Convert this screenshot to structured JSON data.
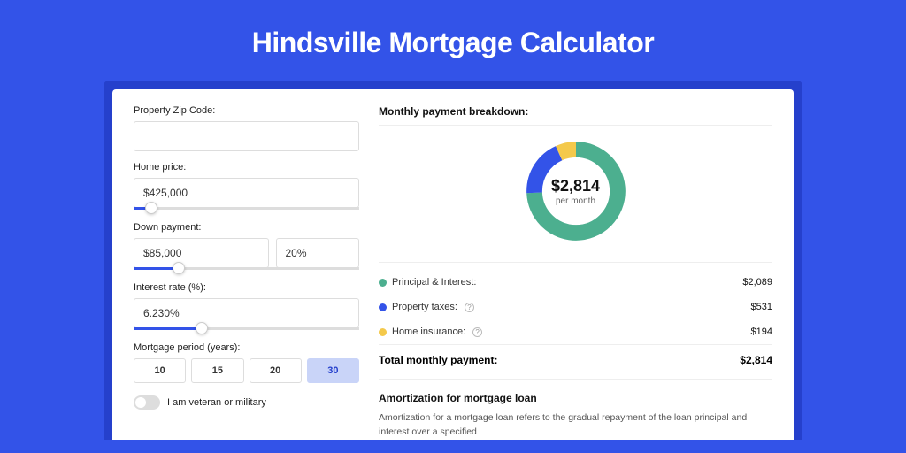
{
  "hero": {
    "title": "Hindsville Mortgage Calculator"
  },
  "form": {
    "zip_label": "Property Zip Code:",
    "zip_value": "",
    "price_label": "Home price:",
    "price_value": "$425,000",
    "price_slider_pct": 8,
    "down_label": "Down payment:",
    "down_value": "$85,000",
    "down_pct": "20%",
    "down_slider_pct": 20,
    "rate_label": "Interest rate (%):",
    "rate_value": "6.230%",
    "rate_slider_pct": 30,
    "period_label": "Mortgage period (years):",
    "periods": [
      "10",
      "15",
      "20",
      "30"
    ],
    "period_active": "30",
    "veteran_label": "I am veteran or military"
  },
  "breakdown": {
    "title": "Monthly payment breakdown:",
    "amount": "$2,814",
    "per": "per month",
    "items": [
      {
        "label": "Principal & Interest:",
        "value": "$2,089",
        "color": "#4caf8f",
        "help": false
      },
      {
        "label": "Property taxes:",
        "value": "$531",
        "color": "#3353e8",
        "help": true
      },
      {
        "label": "Home insurance:",
        "value": "$194",
        "color": "#f4c94b",
        "help": true
      }
    ],
    "total_label": "Total monthly payment:",
    "total_value": "$2,814"
  },
  "amort": {
    "title": "Amortization for mortgage loan",
    "text": "Amortization for a mortgage loan refers to the gradual repayment of the loan principal and interest over a specified"
  },
  "chart_data": {
    "type": "pie",
    "title": "Monthly payment breakdown",
    "series": [
      {
        "name": "Principal & Interest",
        "value": 2089,
        "color": "#4caf8f"
      },
      {
        "name": "Property taxes",
        "value": 531,
        "color": "#3353e8"
      },
      {
        "name": "Home insurance",
        "value": 194,
        "color": "#f4c94b"
      }
    ],
    "total": 2814,
    "center_label": "$2,814 per month"
  }
}
